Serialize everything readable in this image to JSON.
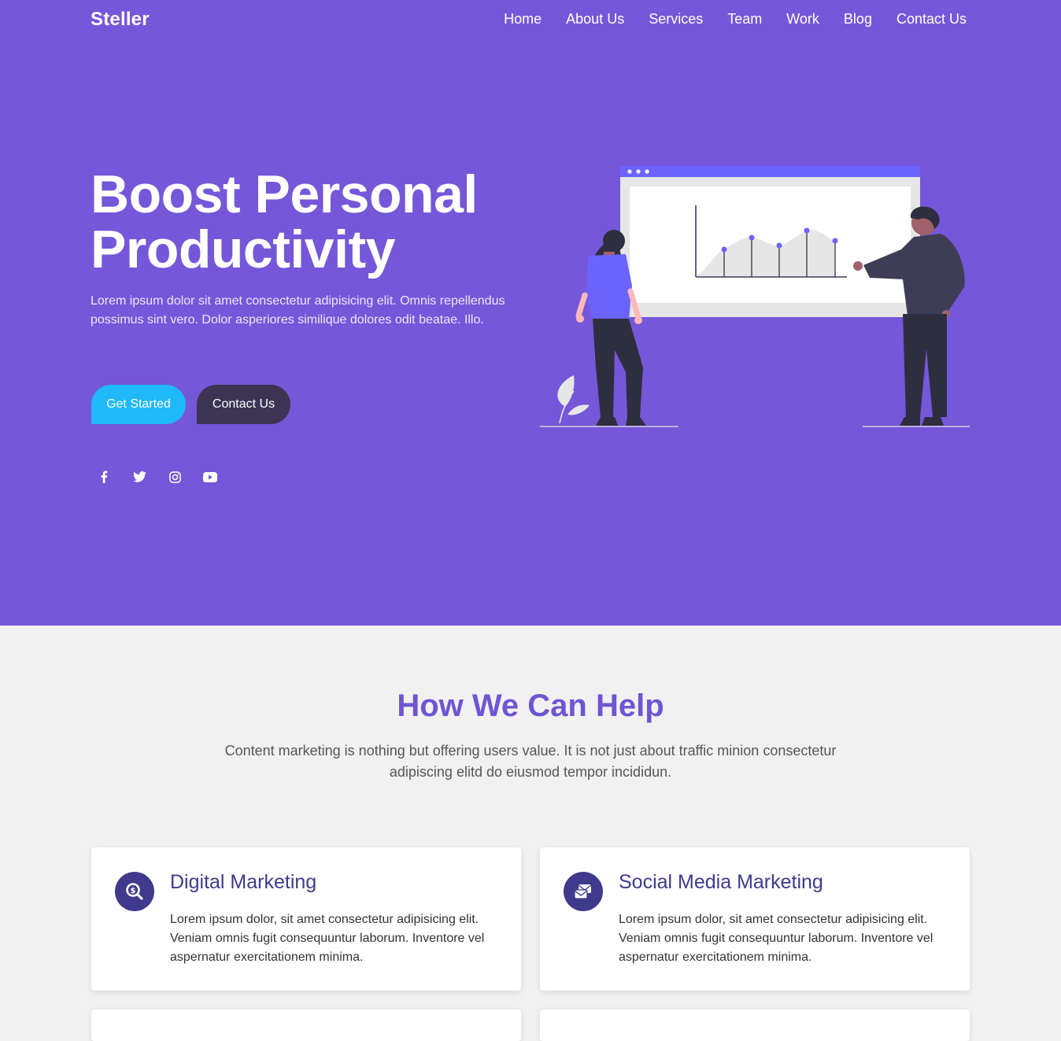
{
  "brand": "Steller",
  "nav": [
    "Home",
    "About Us",
    "Services",
    "Team",
    "Work",
    "Blog",
    "Contact Us"
  ],
  "hero": {
    "title_line1": "Boost Personal",
    "title_line2": "Productivity",
    "description": "Lorem ipsum dolor sit amet consectetur adipisicing elit. Omnis repellendus possimus sint vero. Dolor asperiores similique dolores odit beatae. Illo.",
    "primary_button": "Get Started",
    "secondary_button": "Contact Us",
    "socials": [
      "facebook-icon",
      "twitter-icon",
      "instagram-icon",
      "youtube-icon"
    ]
  },
  "help": {
    "title": "How We Can Help",
    "description": "Content marketing is nothing but offering users value. It is not just about traffic minion consectetur adipiscing elitd do eiusmod tempor incididun.",
    "cards": [
      {
        "icon": "search-dollar-icon",
        "title": "Digital Marketing",
        "text": "Lorem ipsum dolor, sit amet consectetur adipisicing elit. Veniam omnis fugit consequuntur laborum. Inventore vel aspernatur exercitationem minima."
      },
      {
        "icon": "mail-wallet-icon",
        "title": "Social Media Marketing",
        "text": "Lorem ipsum dolor, sit amet consectetur adipisicing elit. Veniam omnis fugit consequuntur laborum. Inventore vel aspernatur exercitationem minima."
      }
    ]
  },
  "colors": {
    "hero_bg": "#7557d9",
    "primary_button": "#1fb8f8",
    "secondary_button": "#3b3453",
    "section_title": "#7054d2",
    "card_accent": "#3f3a8c"
  }
}
